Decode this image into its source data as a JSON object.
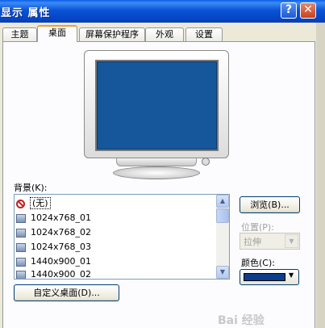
{
  "window": {
    "title": "显示 属性",
    "help_label": "?",
    "close_label": "✕"
  },
  "tabs": [
    {
      "label": "主题",
      "active": false
    },
    {
      "label": "桌面",
      "active": true
    },
    {
      "label": "屏幕保护程序",
      "active": false
    },
    {
      "label": "外观",
      "active": false
    },
    {
      "label": "设置",
      "active": false
    }
  ],
  "background": {
    "label": "背景(K):",
    "items": [
      {
        "label": "(无)",
        "icon": "none-icon",
        "selected": true
      },
      {
        "label": "1024x768_01",
        "icon": "image-file-icon"
      },
      {
        "label": "1024x768_02",
        "icon": "image-file-icon"
      },
      {
        "label": "1024x768_03",
        "icon": "image-file-icon"
      },
      {
        "label": "1440x900_01",
        "icon": "image-file-icon"
      },
      {
        "label": "1440x900_02",
        "icon": "image-file-icon"
      }
    ]
  },
  "buttons": {
    "browse": "浏览(B)...",
    "customize": "自定义桌面(D)..."
  },
  "position": {
    "label": "位置(P):",
    "value": "拉伸"
  },
  "color": {
    "label": "颜色(C):",
    "value": "#0c3d8a"
  },
  "scroll": {
    "up": "▲",
    "down": "▼",
    "dropdown": "▼"
  },
  "watermark": "Bai 经验"
}
